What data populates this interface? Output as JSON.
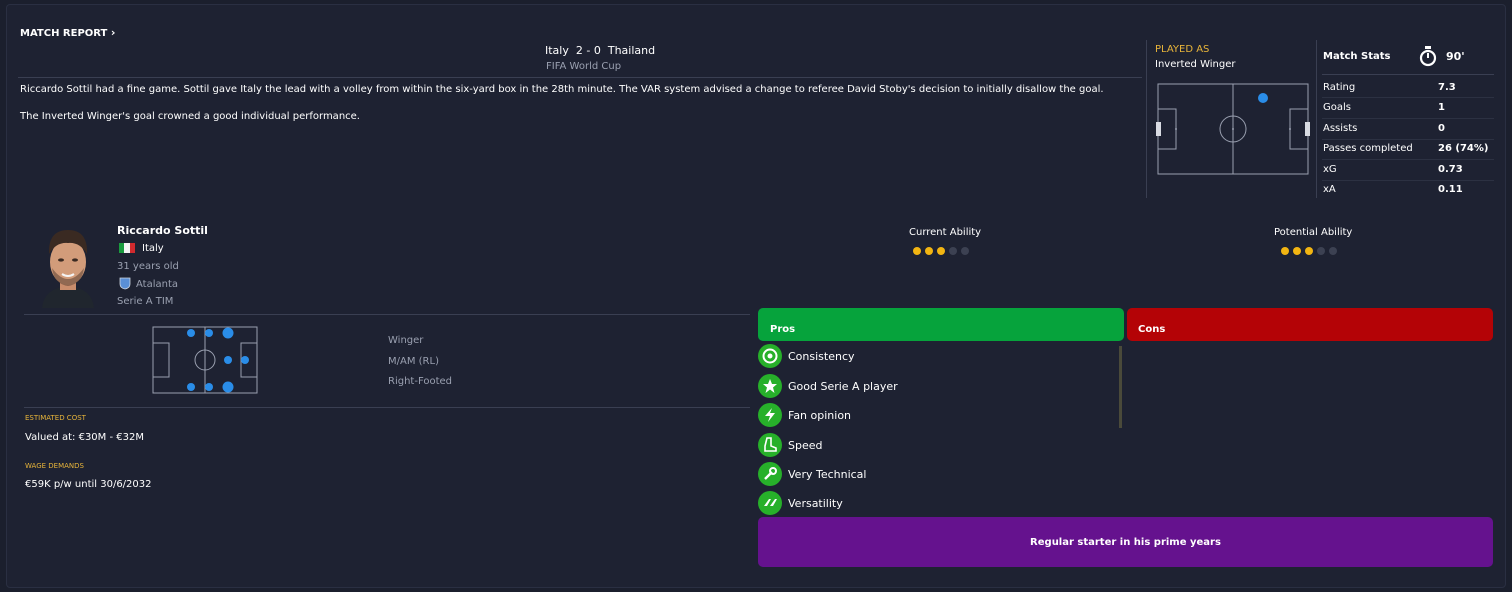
{
  "match_report": {
    "title": "MATCH REPORT",
    "home_team": "Italy",
    "score": "2 - 0",
    "away_team": "Thailand",
    "competition": "FIFA World Cup",
    "summary_line1": "Riccardo Sottil had a fine game. Sottil gave Italy the lead with a volley from within the six-yard box in the 28th minute. The VAR system advised a change to referee David Stoby's decision to initially disallow the goal.",
    "summary_line2": "The Inverted Winger's goal crowned a good individual performance."
  },
  "played_as": {
    "heading": "PLAYED AS",
    "role": "Inverted Winger"
  },
  "match_stats": {
    "heading": "Match Stats",
    "minutes": "90'",
    "rows": [
      {
        "label": "Rating",
        "value": "7.3"
      },
      {
        "label": "Goals",
        "value": "1"
      },
      {
        "label": "Assists",
        "value": "0"
      },
      {
        "label": "Passes completed",
        "value": "26 (74%)"
      },
      {
        "label": "xG",
        "value": "0.73"
      },
      {
        "label": "xA",
        "value": "0.11"
      }
    ]
  },
  "player": {
    "name": "Riccardo Sottil",
    "nation": "Italy",
    "age": "31 years old",
    "club": "Atalanta",
    "league": "Serie A TIM"
  },
  "ability": {
    "current_label": "Current Ability",
    "current_stars": 3,
    "potential_label": "Potential Ability",
    "potential_stars": 3,
    "max_stars": 5
  },
  "positions": {
    "role": "Winger",
    "position": "M/AM (RL)",
    "foot": "Right-Footed"
  },
  "finance": {
    "cost_heading": "ESTIMATED COST",
    "cost_value": "Valued at: €30M - €32M",
    "wage_heading": "WAGE DEMANDS",
    "wage_value": "€59K p/w until 30/6/2032"
  },
  "pros": {
    "heading": "Pros",
    "color": "#06a33c",
    "items": [
      {
        "label": "Consistency",
        "icon": "target-icon"
      },
      {
        "label": "Good Serie A player",
        "icon": "star-icon"
      },
      {
        "label": "Fan opinion",
        "icon": "lightning-icon"
      },
      {
        "label": "Speed",
        "icon": "boot-icon"
      },
      {
        "label": "Very Technical",
        "icon": "wrench-icon"
      },
      {
        "label": "Versatility",
        "icon": "shuffle-icon"
      }
    ]
  },
  "cons": {
    "heading": "Cons",
    "color": "#b40306"
  },
  "verdict": {
    "text": "Regular starter in his prime years",
    "color": "#65128e"
  }
}
